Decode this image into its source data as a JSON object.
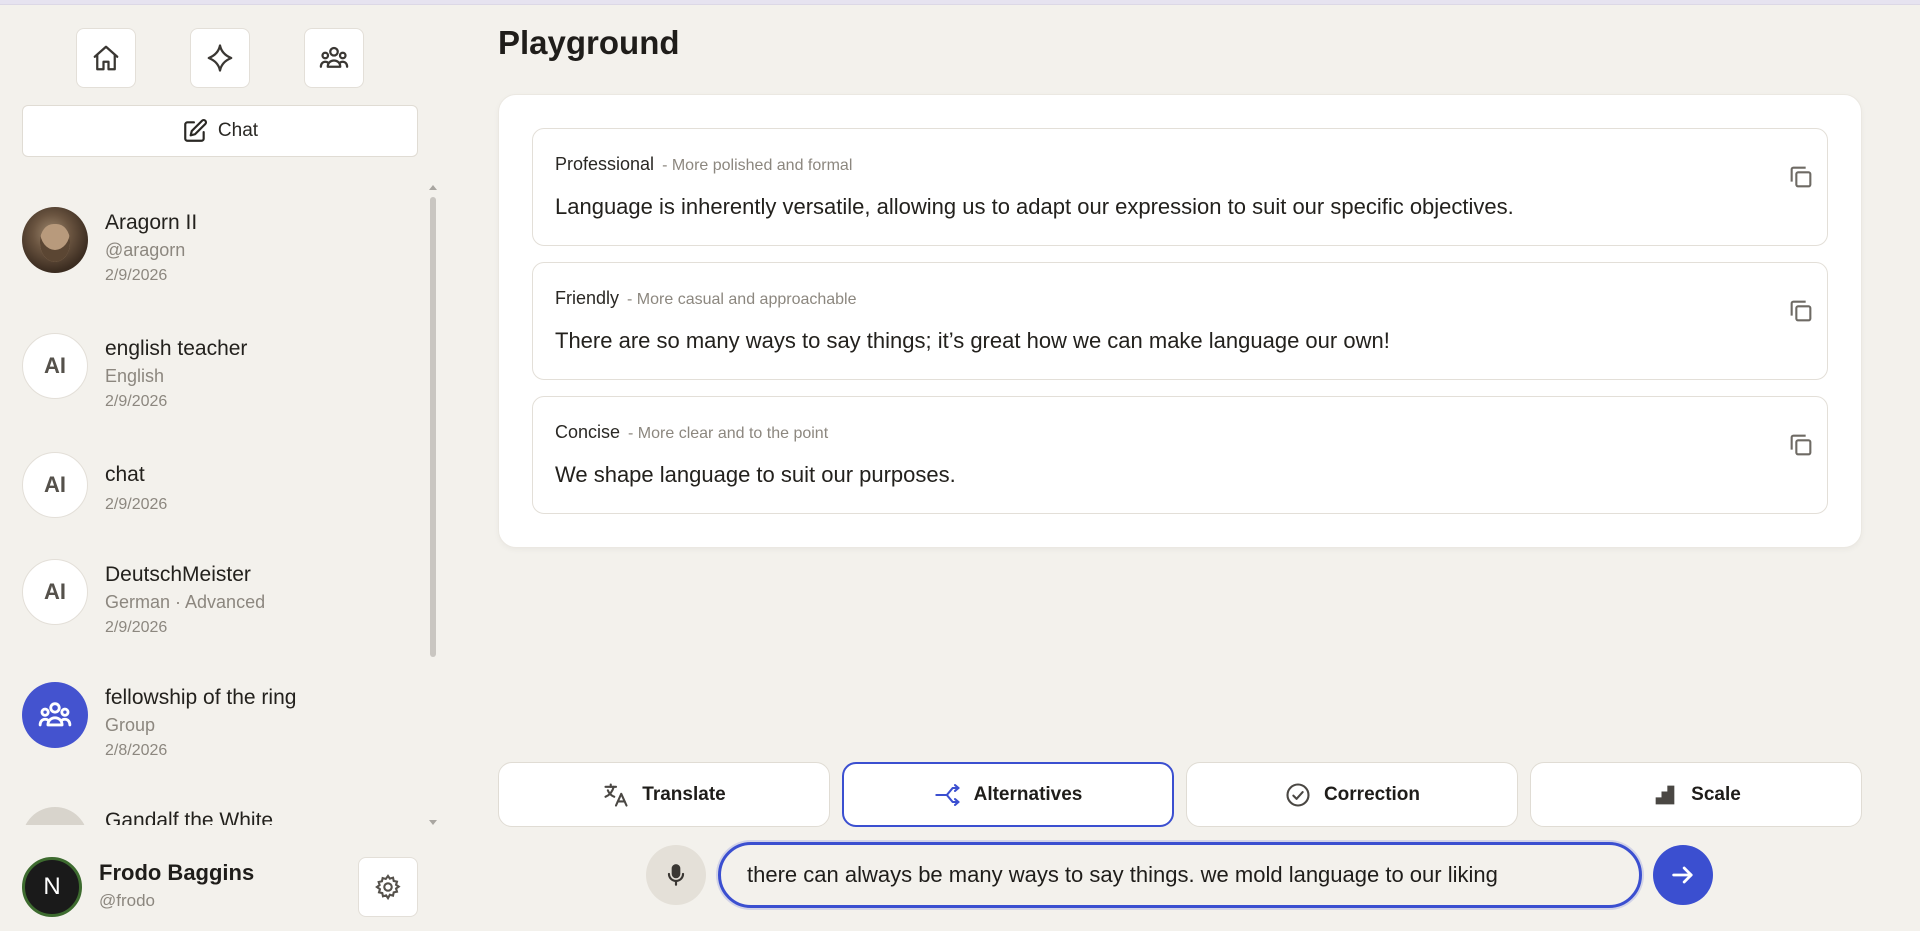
{
  "nav": {
    "icons": [
      "home-icon",
      "sparkle-icon",
      "group-icon"
    ]
  },
  "new_chat_label": "Chat",
  "conversations": [
    {
      "name": "Aragorn II",
      "subtitle": "@aragorn",
      "date": "2/9/2026",
      "avatar": "photo"
    },
    {
      "name": "english teacher",
      "subtitle": "English",
      "date": "2/9/2026",
      "avatar": "AI"
    },
    {
      "name": "chat",
      "subtitle": "",
      "date": "2/9/2026",
      "avatar": "AI"
    },
    {
      "name": "DeutschMeister",
      "subtitle": "German · Advanced",
      "date": "2/9/2026",
      "avatar": "AI"
    },
    {
      "name": "fellowship of the ring",
      "subtitle": "Group",
      "date": "2/8/2026",
      "avatar": "group"
    },
    {
      "name": "Gandalf the White",
      "subtitle": "",
      "date": "",
      "avatar": "photo"
    }
  ],
  "user": {
    "name": "Frodo Baggins",
    "handle": "@frodo",
    "initial": "N"
  },
  "page_title": "Playground",
  "results": [
    {
      "style": "Professional",
      "description": "- More polished and formal",
      "text": "Language is inherently versatile, allowing us to adapt our expression to suit our specific objectives."
    },
    {
      "style": "Friendly",
      "description": "- More casual and approachable",
      "text": "There are so many ways to say things; it’s great how we can make language our own!"
    },
    {
      "style": "Concise",
      "description": "- More clear and to the point",
      "text": "We shape language to suit our purposes."
    }
  ],
  "modes": [
    {
      "label": "Translate",
      "icon": "translate-icon",
      "active": false
    },
    {
      "label": "Alternatives",
      "icon": "branch-icon",
      "active": true
    },
    {
      "label": "Correction",
      "icon": "check-circle-icon",
      "active": false
    },
    {
      "label": "Scale",
      "icon": "stairs-icon",
      "active": false
    }
  ],
  "input": {
    "value": "there can always be many ways to say things. we mold language to our liking"
  },
  "colors": {
    "accent": "#3b4fd0",
    "background": "#f3f1ec"
  }
}
